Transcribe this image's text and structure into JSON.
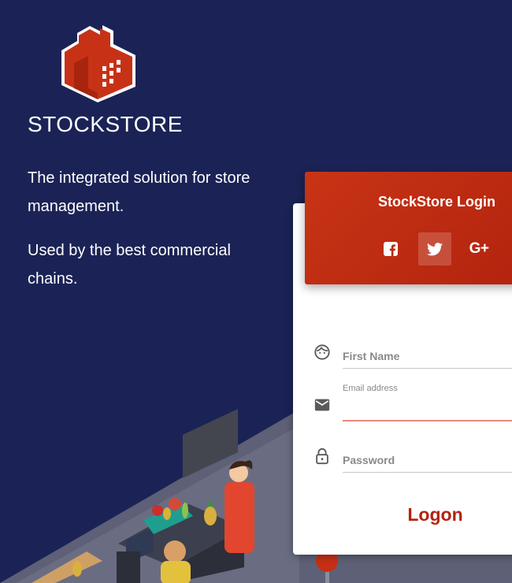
{
  "brand": {
    "name": "STOCKSTORE"
  },
  "hero": {
    "tagline_1": "The integrated solution for store management.",
    "tagline_2": "Used by the best commercial chains."
  },
  "login": {
    "title": "StockStore Login",
    "social": {
      "facebook_icon": "facebook-icon",
      "twitter_icon": "twitter-icon",
      "google_label": "G+"
    },
    "fields": {
      "first_name": {
        "placeholder": "First Name",
        "value": "",
        "icon": "face-icon"
      },
      "email": {
        "label": "Email address",
        "value": "",
        "icon": "mail-icon"
      },
      "password": {
        "placeholder": "Password",
        "value": "",
        "icon": "lock-icon"
      }
    },
    "submit_label": "Logon"
  },
  "colors": {
    "background": "#1b2356",
    "accent": "#b3230e",
    "accent_light": "#c83415",
    "field_active_underline": "#e8877a"
  }
}
